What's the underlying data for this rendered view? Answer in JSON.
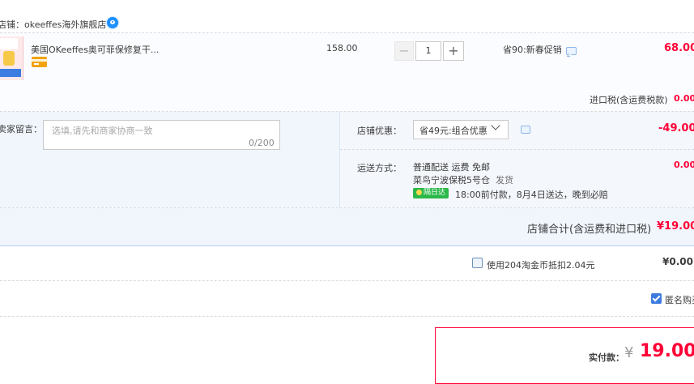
{
  "shop": {
    "label": "店铺：okeeffes海外旗舰店"
  },
  "item": {
    "title": "美国OKeeffes奥可菲保修复干...",
    "unit_price": "158.00",
    "quantity": "1",
    "qty_minus": "−",
    "qty_plus": "+",
    "promo": "省90:新春促销",
    "total": "68.00",
    "tax_label": "进口税(含运费税款)",
    "tax_value": "0.00"
  },
  "message": {
    "label": "卖家留言：",
    "placeholder": "选填,请先和商家协商一致",
    "count": "0/200"
  },
  "coupon": {
    "label": "店铺优惠：",
    "selected": "省49元:组合优惠",
    "discount": "-49.00"
  },
  "shipping": {
    "label": "运送方式：",
    "method": "普通配送 运费 免邮",
    "warehouse": "菜鸟宁波保税5号仓",
    "dispatch": "发货",
    "badge": "隔日达",
    "time_note": "18:00前付款，8月4日送达，晚到必赔",
    "fee": "0.00"
  },
  "subtotal": {
    "label": "店铺合计(含运费和进口税)",
    "value": "¥19.00"
  },
  "coins": {
    "label": "使用204淘金币抵扣2.04元",
    "value": "¥0.00",
    "checked": false
  },
  "anonymous": {
    "label": "匿名购买",
    "checked": true
  },
  "payment": {
    "label": "实付款：",
    "currency": "¥",
    "amount": "19.00"
  },
  "colors": {
    "accent": "#ff0036",
    "panel_bg": "#f1f6fd",
    "divider": "#b7cbe6"
  }
}
